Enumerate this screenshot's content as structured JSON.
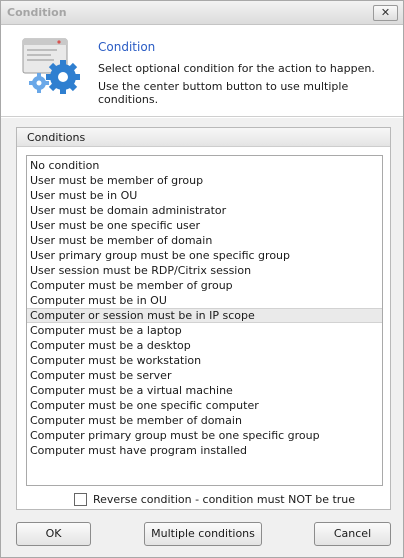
{
  "window": {
    "title": "Condition",
    "close_glyph": "✕"
  },
  "header": {
    "icon": "settings-gear-icon",
    "title": "Condition",
    "line1": "Select optional condition for the action to happen.",
    "line2": "Use the center buttom button to use multiple conditions."
  },
  "conditions": {
    "group_label": "Conditions",
    "selected_index": 10,
    "items": [
      "No condition",
      "User must be member of group",
      "User must be in OU",
      "User must be domain administrator",
      "User must be one specific user",
      "User must be member of domain",
      "User primary group must be one specific group",
      "User session must be RDP/Citrix session",
      "Computer must be member of group",
      "Computer must be in OU",
      "Computer or session must be in IP scope",
      "Computer must be a laptop",
      "Computer must be a desktop",
      "Computer must be workstation",
      "Computer must be server",
      "Computer must be a virtual machine",
      "Computer must be one specific computer",
      "Computer must be member of domain",
      "Computer primary group must be one specific group",
      "Computer must have program installed"
    ]
  },
  "reverse": {
    "label": "Reverse condition - condition must NOT be true",
    "checked": false
  },
  "buttons": {
    "ok": "OK",
    "multiple": "Multiple conditions",
    "cancel": "Cancel"
  }
}
